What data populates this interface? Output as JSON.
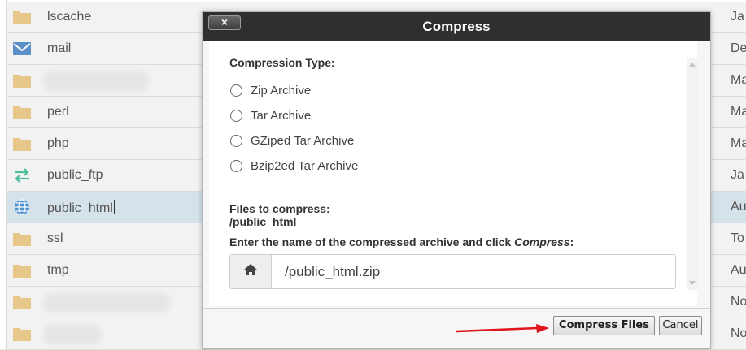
{
  "file_list": {
    "rows": [
      {
        "name": "lscache",
        "date": "Ja",
        "icon": "folder-icon",
        "blurred": false
      },
      {
        "name": "mail",
        "date": "De",
        "icon": "mail-icon",
        "blurred": false
      },
      {
        "name": "",
        "date": "Ma",
        "icon": "folder-icon",
        "blurred": true
      },
      {
        "name": "perl",
        "date": "Ma",
        "icon": "folder-icon",
        "blurred": false
      },
      {
        "name": "php",
        "date": "Ma",
        "icon": "folder-icon",
        "blurred": false
      },
      {
        "name": "public_ftp",
        "date": "Ja",
        "icon": "transfer-icon",
        "blurred": false
      },
      {
        "name": "public_html",
        "date": "Au",
        "icon": "globe-icon",
        "blurred": false,
        "selected": true
      },
      {
        "name": "ssl",
        "date": "To",
        "icon": "folder-icon",
        "blurred": false
      },
      {
        "name": "tmp",
        "date": "Au",
        "icon": "folder-icon",
        "blurred": false
      },
      {
        "name": "",
        "date": "No",
        "icon": "folder-icon",
        "blurred": true
      },
      {
        "name": "",
        "date": "No",
        "icon": "folder-icon",
        "blurred": true
      }
    ]
  },
  "dialog": {
    "title": "Compress",
    "close_label": "×",
    "compression_type_label": "Compression Type:",
    "options": [
      {
        "label": "Zip Archive",
        "selected": false
      },
      {
        "label": "Tar Archive",
        "selected": false
      },
      {
        "label": "GZiped Tar Archive",
        "selected": false
      },
      {
        "label": "Bzip2ed Tar Archive",
        "selected": false
      }
    ],
    "files_label": "Files to compress:",
    "files_value": "/public_html",
    "instruction_prefix": "Enter the name of the compressed archive and click ",
    "instruction_emphasis": "Compress",
    "instruction_suffix": ":",
    "archive_name": "/public_html.zip",
    "addon_icon": "home-icon",
    "compress_button": "Compress Files",
    "cancel_button": "Cancel"
  },
  "colors": {
    "title_bar": "#2f2f2f",
    "folder": "#e8c88a",
    "mail": "#5b8fc7",
    "transfer": "#4dbf9f",
    "globe": "#4a8fd0",
    "annotation_arrow": "#e0141b",
    "selected_row": "#d6e2ea"
  }
}
